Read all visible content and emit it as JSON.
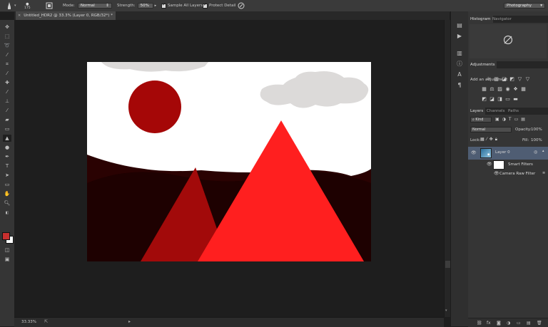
{
  "options_bar": {
    "brush_size": "175",
    "mode_label": "Mode:",
    "mode_value": "Normal",
    "strength_label": "Strength:",
    "strength_value": "50%",
    "sample_all_layers": "Sample All Layers",
    "protect_detail": "Protect Detail",
    "workspace": "Photography"
  },
  "document_tab": {
    "title": "Untitled_HDR2 @ 33.3% (Layer 0, RGB/32*) *"
  },
  "status_bar": {
    "zoom": "33.33%"
  },
  "panels": {
    "top_tabs": [
      "Histogram",
      "Navigator"
    ],
    "adjustments_tab": "Adjustments",
    "add_adjustment": "Add an adjustment",
    "layers_tabs": [
      "Layers",
      "Channels",
      "Paths"
    ],
    "kind_filter": "Kind",
    "blend_mode": "Normal",
    "opacity_label": "Opacity:",
    "opacity_value": "100%",
    "lock_label": "Lock:",
    "fill_label": "Fill:",
    "fill_value": "100%",
    "layers": [
      {
        "name": "Layer 0"
      },
      {
        "name": "Smart Filters"
      },
      {
        "name": "Camera Raw Filter"
      }
    ]
  },
  "colors": {
    "foreground": "#c8302f",
    "background": "#ffffff",
    "sun": "#a50707",
    "big_peak": "#ff1f1f",
    "small_peak": "#a20a0a",
    "hills": "#2a0202",
    "cloud": "#dcdad9"
  }
}
